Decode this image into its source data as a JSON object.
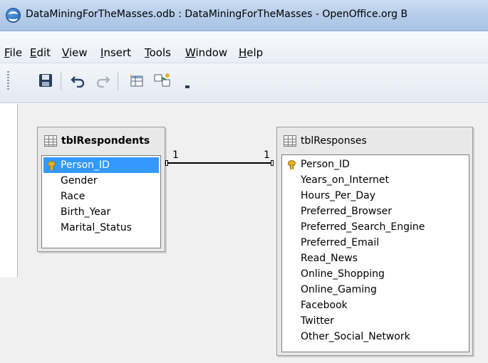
{
  "window": {
    "title": "DataMiningForTheMasses.odb : DataMiningForTheMasses - OpenOffice.org B"
  },
  "menu": [
    {
      "label": "File",
      "accel": "F",
      "rest": "ile"
    },
    {
      "label": "Edit",
      "accel": "E",
      "rest": "dit"
    },
    {
      "label": "View",
      "accel": "V",
      "rest": "iew"
    },
    {
      "label": "Insert",
      "accel": "I",
      "rest": "nsert"
    },
    {
      "label": "Tools",
      "accel": "T",
      "rest": "ools"
    },
    {
      "label": "Window",
      "accel": "W",
      "rest": "indow"
    },
    {
      "label": "Help",
      "accel": "H",
      "rest": "elp"
    }
  ],
  "toolbar": {
    "icons": [
      "save-icon",
      "undo-icon",
      "redo-icon",
      "add-table-icon",
      "new-relation-icon",
      "toolbar-options-icon"
    ]
  },
  "tables": [
    {
      "name": "tblRespondents",
      "fields": [
        "Person_ID",
        "Gender",
        "Race",
        "Birth_Year",
        "Marital_Status"
      ],
      "primary_key": "Person_ID",
      "selected": "Person_ID"
    },
    {
      "name": "tblResponses",
      "fields": [
        "Person_ID",
        "Years_on_Internet",
        "Hours_Per_Day",
        "Preferred_Browser",
        "Preferred_Search_Engine",
        "Preferred_Email",
        "Read_News",
        "Online_Shopping",
        "Online_Gaming",
        "Facebook",
        "Twitter",
        "Other_Social_Network"
      ],
      "primary_key": "Person_ID"
    }
  ],
  "relation": {
    "left_cardinality": "1",
    "right_cardinality": "1"
  },
  "colors": {
    "selection": "#3399ff",
    "titlebar": "#b4cce9",
    "canvas": "#f0f0f0"
  }
}
